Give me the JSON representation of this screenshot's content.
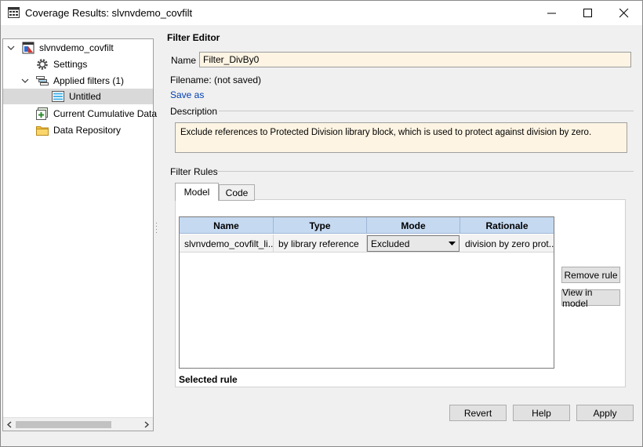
{
  "window": {
    "title": "Coverage Results: slvnvdemo_covfilt",
    "icon": "window-app-icon"
  },
  "tree": {
    "items": [
      {
        "label": "slvnvdemo_covfilt",
        "icon": "model-icon",
        "expanded": true
      },
      {
        "label": "Settings",
        "icon": "gear-icon"
      },
      {
        "label": "Applied filters (1)",
        "icon": "filter-icon",
        "expanded": true
      },
      {
        "label": "Untitled",
        "icon": "filter-file-icon",
        "selected": true
      },
      {
        "label": "Current Cumulative Data",
        "icon": "cumulative-data-icon"
      },
      {
        "label": "Data Repository",
        "icon": "folder-icon"
      }
    ]
  },
  "editor": {
    "heading": "Filter Editor",
    "name_label": "Name",
    "name_value": "Filter_DivBy0",
    "filename_text": "Filename: (not saved)",
    "save_as": "Save as",
    "description_label": "Description",
    "description_text": "Exclude references to Protected Division library block, which is used to protect against division by zero.",
    "rules_label": "Filter Rules",
    "tabs": [
      {
        "label": "Model",
        "active": true
      },
      {
        "label": "Code",
        "active": false
      }
    ],
    "table": {
      "columns": [
        "Name",
        "Type",
        "Mode",
        "Rationale"
      ],
      "rows": [
        {
          "name": "slvnvdemo_covfilt_li...",
          "type": "by library reference",
          "mode": "Excluded",
          "rationale": "division by zero prot..."
        }
      ]
    },
    "remove_rule": "Remove rule",
    "view_in_model": "View in model",
    "selected_rule": "Selected rule"
  },
  "footer": {
    "revert": "Revert",
    "help": "Help",
    "apply": "Apply"
  },
  "colors": {
    "header_blue": "#c5d9f1",
    "input_cream": "#fdf4e3",
    "link_blue": "#003fb0"
  }
}
